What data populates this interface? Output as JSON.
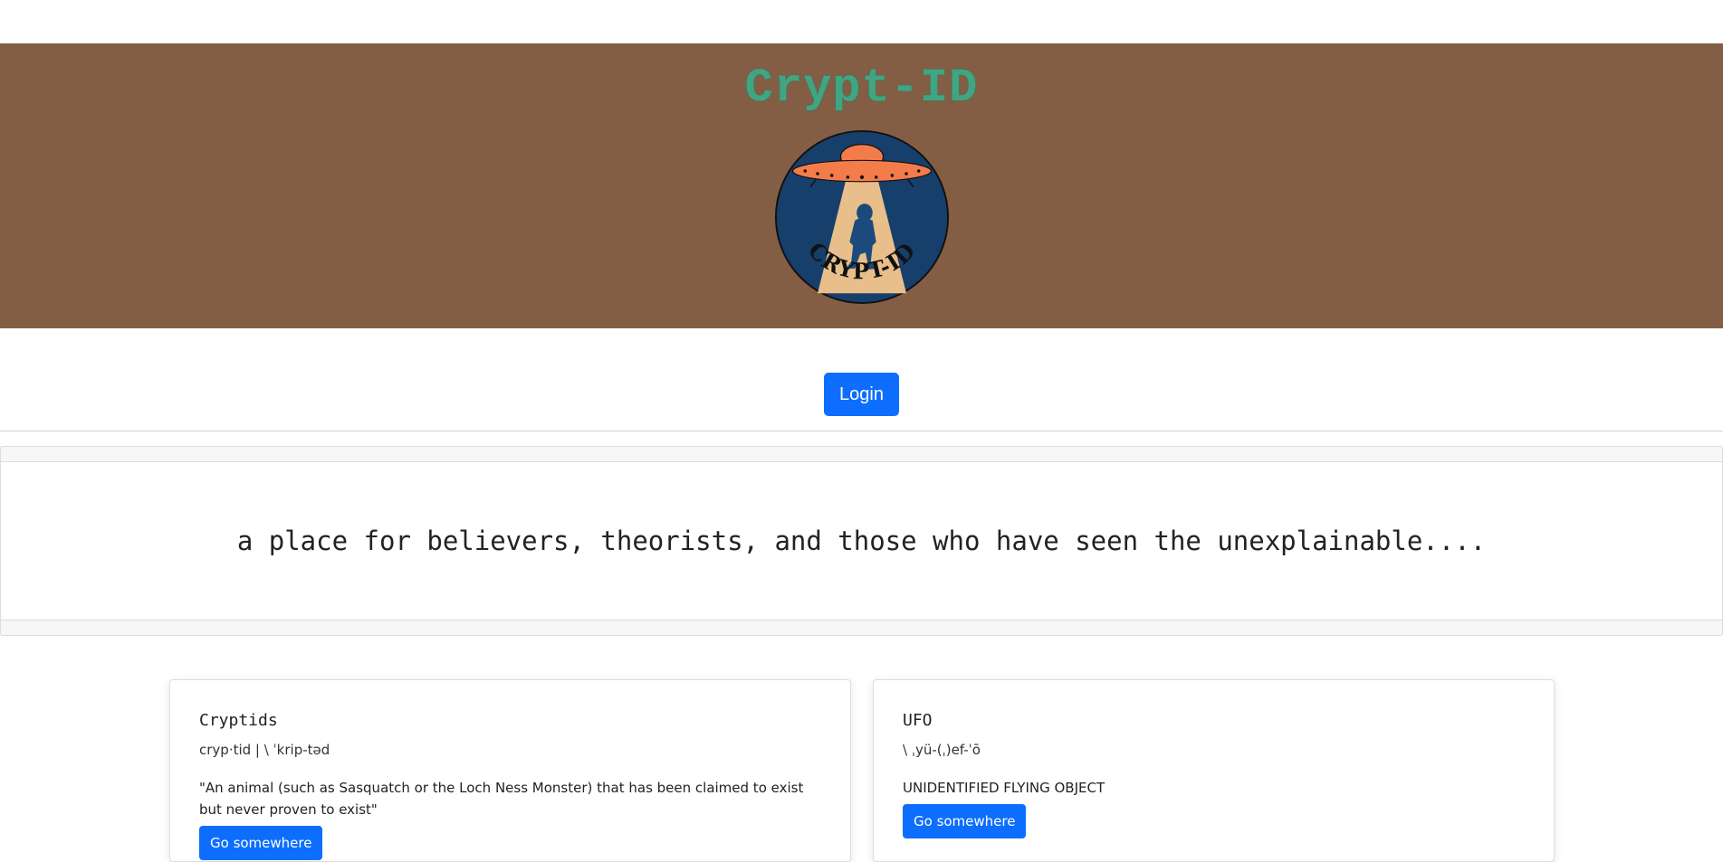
{
  "header": {
    "title": "Crypt-ID",
    "logo_text": "CRYPT-ID"
  },
  "auth": {
    "login_label": "Login"
  },
  "tagline": "a place for believers, theorists, and those who have seen the unexplainable....",
  "cards": [
    {
      "title": "Cryptids",
      "subtitle": "cryp·tid | \\ ˈkrip-təd",
      "text": "\"An animal (such as Sasquatch or the Loch Ness Monster) that has been claimed to exist but never proven to exist\"",
      "button_label": "Go somewhere"
    },
    {
      "title": "UFO",
      "subtitle": "\\ ˌyü-(ˌ)ef-ˈō",
      "text": "UNIDENTIFIED FLYING OBJECT",
      "button_label": "Go somewhere"
    }
  ],
  "colors": {
    "hero_bg": "#835e45",
    "title": "#3fa582",
    "primary": "#0d6efd",
    "logo_circle": "#173f6b",
    "ufo": "#f47c4a",
    "beam": "#e8bf8a"
  },
  "icons": {
    "logo": "ufo-abducting-bigfoot-logo"
  }
}
